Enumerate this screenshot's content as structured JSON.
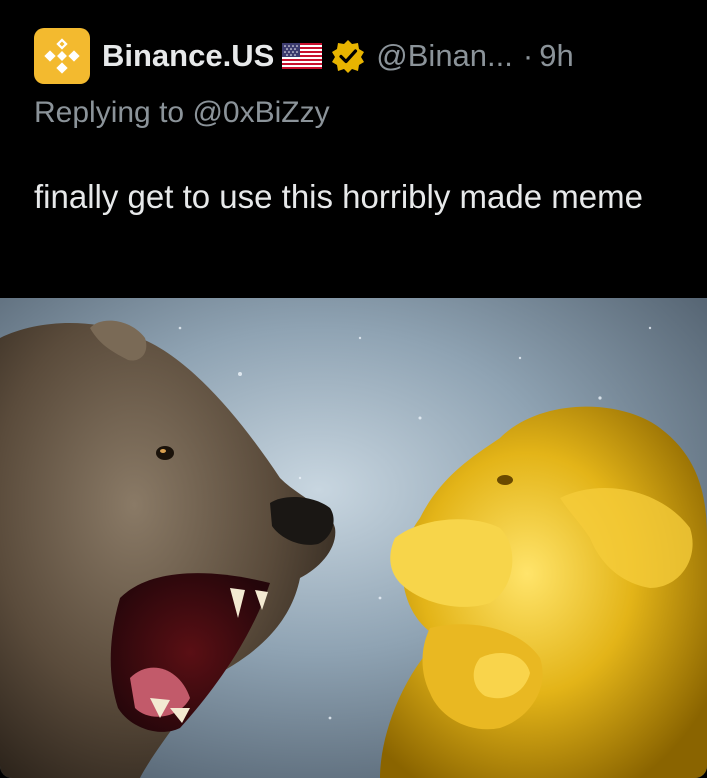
{
  "tweet": {
    "display_name": "Binance.US",
    "flag_icon": "us-flag-icon",
    "verified_icon": "gold-verified-badge-icon",
    "handle": "@Binan...",
    "separator": "·",
    "time": "9h",
    "replying_label": "Replying to ",
    "replying_to": "@0xBiZzy",
    "text": "finally get to use this horribly made meme"
  },
  "colors": {
    "background": "#000000",
    "brand": "#f3ba2f",
    "verified_gold": "#e8b400",
    "muted_text": "#8b9399",
    "primary_text": "#e7e9ea"
  },
  "media": {
    "type": "image",
    "subjects": [
      "bear-icon",
      "golden-ape-icon"
    ]
  }
}
